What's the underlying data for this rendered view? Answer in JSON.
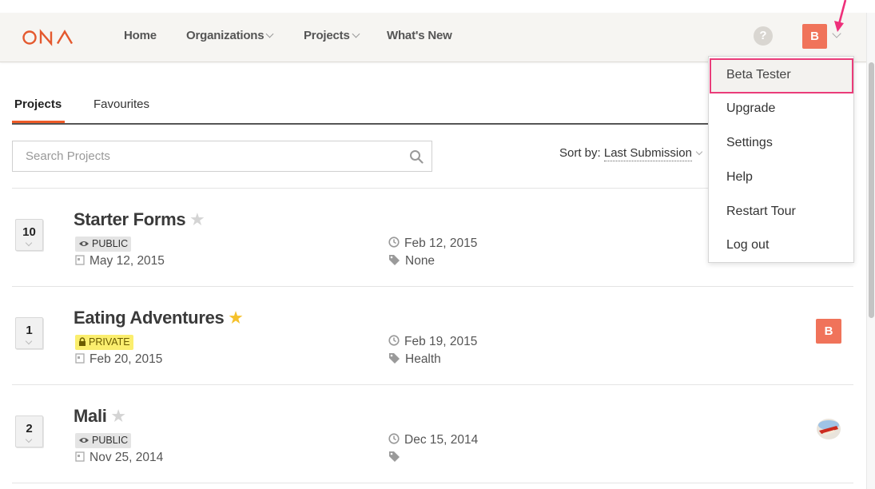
{
  "brand": {
    "name": "ONA",
    "color": "#e4592e"
  },
  "nav": {
    "items": [
      {
        "label": "Home",
        "has_caret": false
      },
      {
        "label": "Organizations",
        "has_caret": true
      },
      {
        "label": "Projects",
        "has_caret": true
      },
      {
        "label": "What's New",
        "has_caret": false
      }
    ],
    "help_icon": "question-circle-icon",
    "user_initial": "B"
  },
  "user_menu": {
    "items": [
      "Beta Tester",
      "Upgrade",
      "Settings",
      "Help",
      "Restart Tour",
      "Log out"
    ],
    "highlighted": "Beta Tester",
    "highlight_color": "#ea3c7a"
  },
  "tabs": [
    {
      "label": "Projects",
      "active": true
    },
    {
      "label": "Favourites",
      "active": false
    }
  ],
  "search": {
    "placeholder": "Search Projects",
    "value": ""
  },
  "sort": {
    "label": "Sort by:",
    "value": "Last Submission"
  },
  "projects": [
    {
      "count": "10",
      "title": "Starter Forms",
      "starred": false,
      "visibility": "PUBLIC",
      "created": "May 12, 2015",
      "last_submission": "Feb 12, 2015",
      "tags": "None",
      "owner_avatar": ""
    },
    {
      "count": "1",
      "title": "Eating Adventures",
      "starred": true,
      "visibility": "PRIVATE",
      "created": "Feb 20, 2015",
      "last_submission": "Feb 19, 2015",
      "tags": "Health",
      "owner_avatar": "B"
    },
    {
      "count": "2",
      "title": "Mali",
      "starred": false,
      "visibility": "PUBLIC",
      "created": "Nov 25, 2014",
      "last_submission": "Dec 15, 2014",
      "tags": "",
      "owner_avatar": "image"
    }
  ],
  "colors": {
    "accent": "#ee5b28",
    "avatar": "#f0735a",
    "private_badge": "#fbee6e",
    "public_badge": "#e4e4e4",
    "star_on": "#f5c12c"
  }
}
